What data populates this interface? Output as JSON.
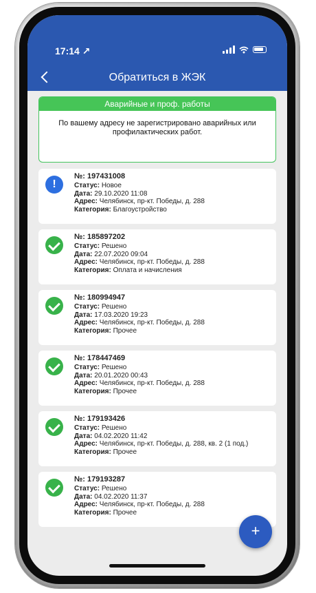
{
  "status_bar": {
    "time": "17:14 ↗"
  },
  "header": {
    "title": "Обратиться в ЖЭК"
  },
  "emergency": {
    "heading": "Аварийные и проф. работы",
    "message": "По вашему адресу не зарегистрировано аварийных или профилактических работ."
  },
  "labels": {
    "number": "№:",
    "status": "Статус:",
    "date": "Дата:",
    "address": "Адрес:",
    "category": "Категория:"
  },
  "tickets": [
    {
      "icon": "exclamation-icon",
      "number": "197431008",
      "status": "Новое",
      "date": "29.10.2020 11:08",
      "address": "Челябинск, пр-кт. Победы, д. 288",
      "category": "Благоустройство"
    },
    {
      "icon": "check-icon",
      "number": "185897202",
      "status": "Решено",
      "date": "22.07.2020 09:04",
      "address": "Челябинск, пр-кт. Победы, д. 288",
      "category": "Оплата и начисления"
    },
    {
      "icon": "check-icon",
      "number": "180994947",
      "status": "Решено",
      "date": "17.03.2020 19:23",
      "address": "Челябинск, пр-кт. Победы, д. 288",
      "category": "Прочее"
    },
    {
      "icon": "check-icon",
      "number": "178447469",
      "status": "Решено",
      "date": "20.01.2020 00:43",
      "address": "Челябинск, пр-кт. Победы, д. 288",
      "category": "Прочее"
    },
    {
      "icon": "check-icon",
      "number": "179193426",
      "status": "Решено",
      "date": "04.02.2020 11:42",
      "address": "Челябинск, пр-кт. Победы, д. 288, кв. 2 (1 под.)",
      "category": "Прочее"
    },
    {
      "icon": "check-icon",
      "number": "179193287",
      "status": "Решено",
      "date": "04.02.2020 11:37",
      "address": "Челябинск, пр-кт. Победы, д. 288",
      "category": "Прочее"
    }
  ],
  "fab": {
    "label": "+"
  },
  "colors": {
    "header": "#2b58b0",
    "success": "#38b24a",
    "new": "#2d6fe0",
    "emergency": "#46c557"
  }
}
